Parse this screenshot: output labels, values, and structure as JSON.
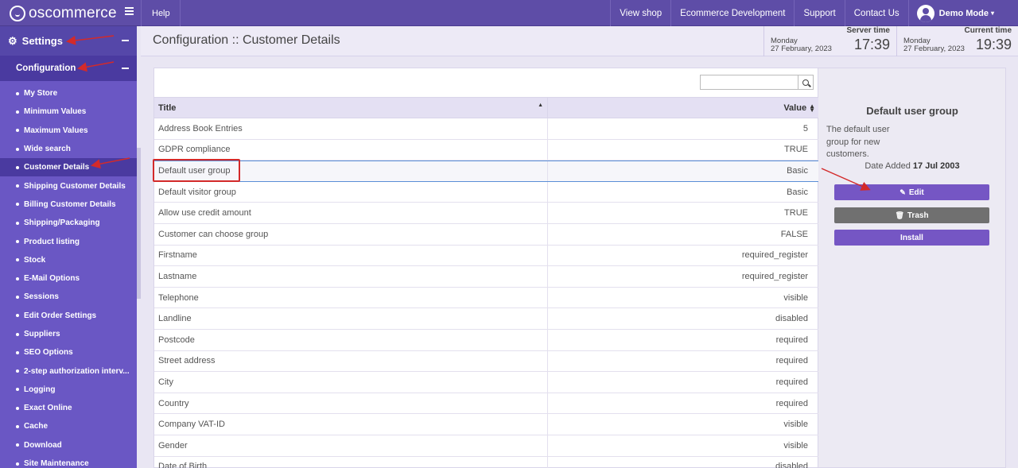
{
  "topbar": {
    "logo_text": "oscommerce",
    "help": "Help",
    "nav": [
      "View shop",
      "Ecommerce Development",
      "Support",
      "Contact Us"
    ],
    "user": "Demo Mode",
    "caret": "▾"
  },
  "sidebar": {
    "settings_label": "Settings",
    "config_label": "Configuration",
    "items": [
      {
        "label": "My Store"
      },
      {
        "label": "Minimum Values"
      },
      {
        "label": "Maximum Values"
      },
      {
        "label": "Wide search"
      },
      {
        "label": "Customer Details",
        "active": true
      },
      {
        "label": "Shipping Customer Details"
      },
      {
        "label": "Billing Customer Details"
      },
      {
        "label": "Shipping/Packaging"
      },
      {
        "label": "Product listing"
      },
      {
        "label": "Stock"
      },
      {
        "label": "E-Mail Options"
      },
      {
        "label": "Sessions"
      },
      {
        "label": "Edit Order Settings"
      },
      {
        "label": "Suppliers"
      },
      {
        "label": "SEO Options"
      },
      {
        "label": "2-step authorization interv..."
      },
      {
        "label": "Logging"
      },
      {
        "label": "Exact Online"
      },
      {
        "label": "Cache"
      },
      {
        "label": "Download"
      },
      {
        "label": "Site Maintenance"
      }
    ]
  },
  "header": {
    "title": "Configuration :: Customer Details",
    "server_time": {
      "label": "Server time",
      "day": "Monday",
      "date": "27 February, 2023",
      "time": "17:39"
    },
    "current_time": {
      "label": "Current time",
      "day": "Monday",
      "date": "27 February, 2023",
      "time": "19:39"
    }
  },
  "search": {
    "value": "",
    "placeholder": ""
  },
  "table": {
    "col_title": "Title",
    "col_value": "Value",
    "rows": [
      {
        "title": "Address Book Entries",
        "value": "5"
      },
      {
        "title": "GDPR compliance",
        "value": "TRUE"
      },
      {
        "title": "Default user group",
        "value": "Basic",
        "selected": true
      },
      {
        "title": "Default visitor group",
        "value": "Basic"
      },
      {
        "title": "Allow use credit amount",
        "value": "TRUE"
      },
      {
        "title": "Customer can choose group",
        "value": "FALSE"
      },
      {
        "title": "Firstname",
        "value": "required_register"
      },
      {
        "title": "Lastname",
        "value": "required_register"
      },
      {
        "title": "Telephone",
        "value": "visible"
      },
      {
        "title": "Landline",
        "value": "disabled"
      },
      {
        "title": "Postcode",
        "value": "required"
      },
      {
        "title": "Street address",
        "value": "required"
      },
      {
        "title": "City",
        "value": "required"
      },
      {
        "title": "Country",
        "value": "required"
      },
      {
        "title": "Company VAT-ID",
        "value": "visible"
      },
      {
        "title": "Gender",
        "value": "visible"
      },
      {
        "title": "Date of Birth",
        "value": "disabled"
      }
    ]
  },
  "info": {
    "title": "Default user group",
    "description": "The default user group for new customers.",
    "date_label": "Date Added",
    "date_value": "17 Jul 2003",
    "edit": "Edit",
    "trash": "Trash",
    "install": "Install"
  },
  "colors": {
    "brand": "#5e4da7",
    "sidebar": "#6a57c4",
    "accent_button": "#7556c4",
    "annotation": "#d32a2a"
  }
}
